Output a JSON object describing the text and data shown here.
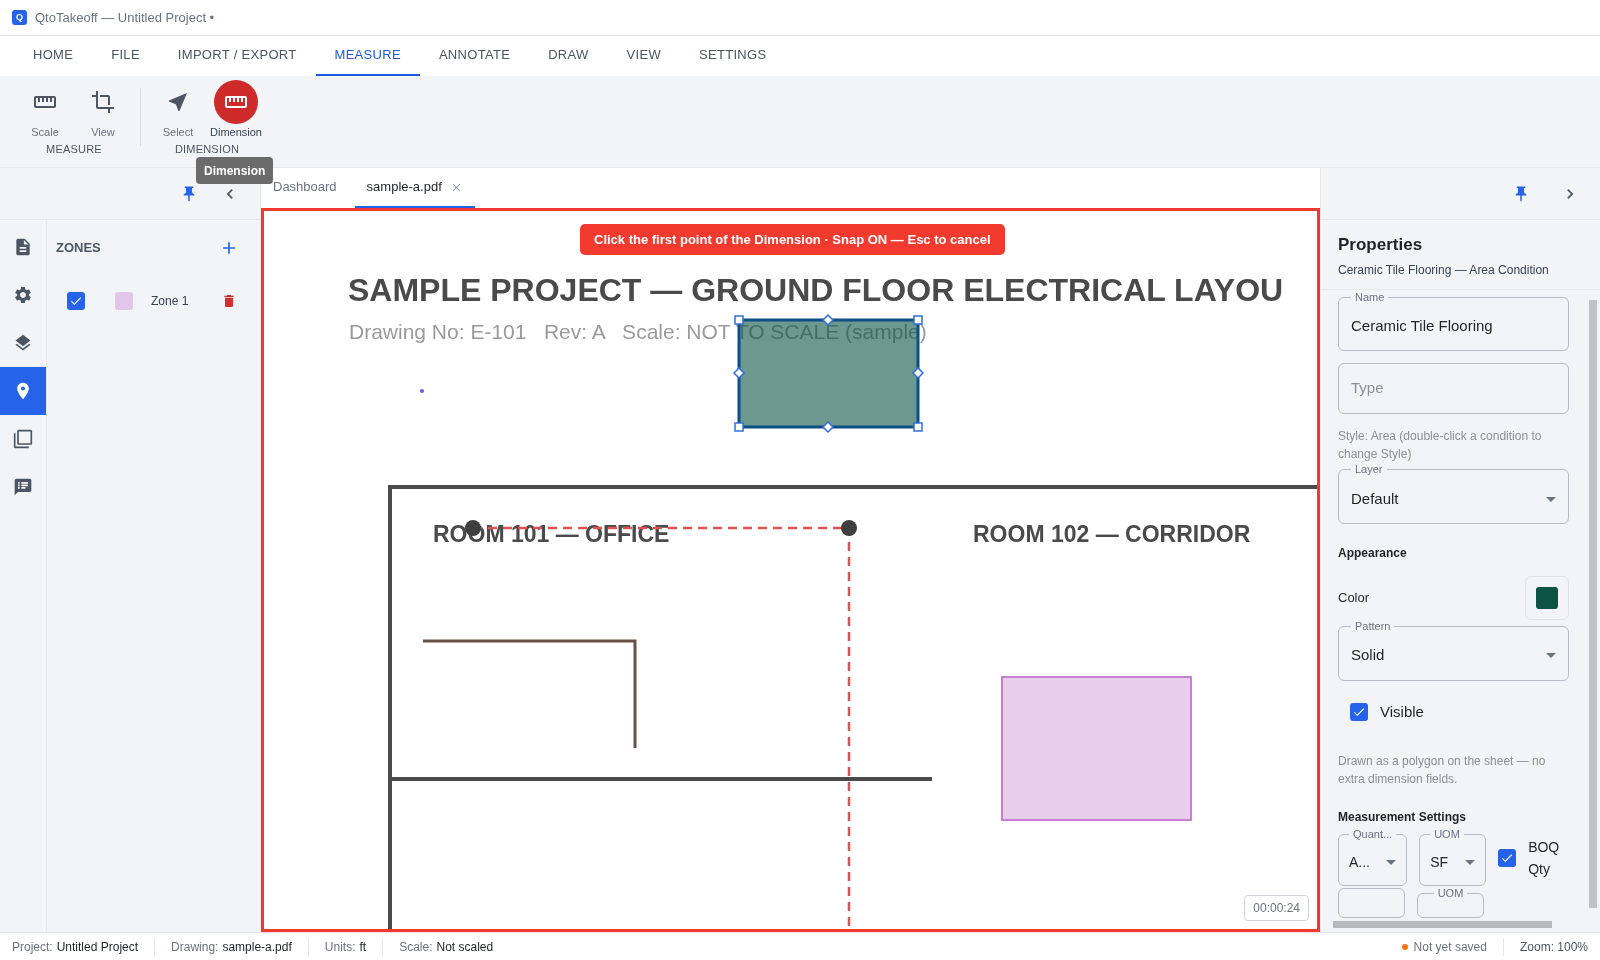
{
  "window": {
    "logo_letter": "Q",
    "title": "QtoTakeoff — Untitled Project •"
  },
  "menu_tabs": [
    {
      "label": "HOME",
      "selected": false
    },
    {
      "label": "FILE",
      "selected": false
    },
    {
      "label": "IMPORT / EXPORT",
      "selected": false
    },
    {
      "label": "MEASURE",
      "selected": true
    },
    {
      "label": "ANNOTATE",
      "selected": false
    },
    {
      "label": "DRAW",
      "selected": false
    },
    {
      "label": "VIEW",
      "selected": false
    },
    {
      "label": "SETTINGS",
      "selected": false
    }
  ],
  "ribbon": [
    {
      "label": "MEASURE",
      "tools": [
        {
          "label": "Scale",
          "selected": false
        },
        {
          "label": "View",
          "selected": false
        }
      ]
    },
    {
      "label": "DIMENSION",
      "tools": [
        {
          "label": "Select",
          "selected": false
        },
        {
          "label": "Dimension",
          "selected": true
        }
      ]
    }
  ],
  "tooltip": "Dimension",
  "left_rail": [
    {
      "selected": false
    },
    {
      "selected": false
    },
    {
      "selected": false
    },
    {
      "selected": true
    },
    {
      "selected": false
    },
    {
      "selected": false
    }
  ],
  "zones_panel": {
    "title": "ZONES",
    "zones": [
      {
        "name": "Zone 1",
        "checked": true,
        "color": "#e1c6ea"
      }
    ]
  },
  "doc_tabs": [
    {
      "label": "Dashboard",
      "selected": false,
      "closable": false
    },
    {
      "label": "sample-a.pdf",
      "selected": true,
      "closable": true
    }
  ],
  "canvas": {
    "hint": "Click the first point of the Dimension · Snap ON — Esc to cancel",
    "title": "SAMPLE PROJECT — GROUND FLOOR ELECTRICAL LAYOU",
    "subtitle": "Drawing No: E-101   Rev: A   Scale: NOT TO SCALE (sample)",
    "rooms": [
      "ROOM 101 — OFFICE",
      "ROOM 102 — CORRIDOR"
    ],
    "timer": "00:00:24"
  },
  "properties": {
    "title": "Properties",
    "subtitle": "Ceramic Tile Flooring — Area Condition",
    "name": {
      "label": "Name",
      "value": "Ceramic Tile Flooring"
    },
    "type": {
      "placeholder": "Type"
    },
    "style_note": "Style: Area (double-click a condition to change Style)",
    "layer": {
      "label": "Layer",
      "value": "Default"
    },
    "appearance_title": "Appearance",
    "color": {
      "label": "Color",
      "color": "#0b5345"
    },
    "pattern": {
      "label": "Pattern",
      "value": "Solid"
    },
    "visible": {
      "label": "Visible",
      "checked": true
    },
    "note": "Drawn as a polygon on the sheet — no extra dimension fields.",
    "measurement_title": "Measurement Settings",
    "quantity": {
      "label": "Quant...",
      "value": "A..."
    },
    "uom": {
      "label": "UOM",
      "value": "SF"
    },
    "boq": {
      "label": "BOQ Qty",
      "checked": true
    },
    "next_row": {
      "uom_label": "UOM"
    }
  },
  "status_bar": {
    "items": [
      {
        "label": "Project:",
        "value": "Untitled Project"
      },
      {
        "label": "Drawing:",
        "value": "sample-a.pdf"
      },
      {
        "label": "Units:",
        "value": "ft"
      },
      {
        "label": "Scale:",
        "value": "Not scaled"
      }
    ],
    "save_status": "Not yet saved",
    "zoom": "Zoom: 100%"
  }
}
